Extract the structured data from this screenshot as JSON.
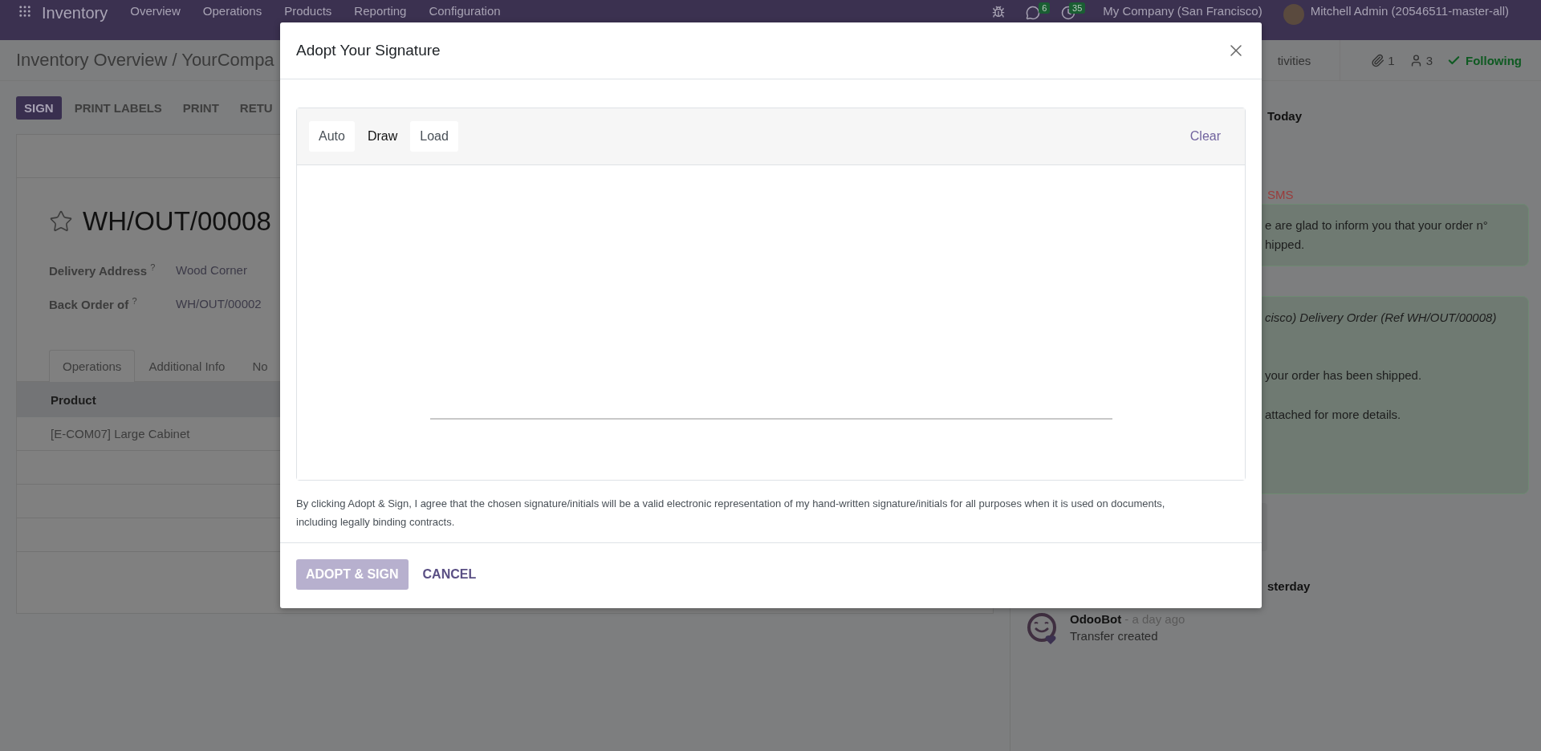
{
  "navbar": {
    "app_name": "Inventory",
    "menu": [
      "Overview",
      "Operations",
      "Products",
      "Reporting",
      "Configuration"
    ],
    "messages_badge": "6",
    "activities_badge": "35",
    "company": "My Company (San Francisco)",
    "user": "Mitchell Admin (20546511-master-all)"
  },
  "breadcrumb": "Inventory Overview / YourCompa",
  "action_buttons": [
    {
      "label": "SIGN",
      "primary": true
    },
    {
      "label": "PRINT LABELS",
      "primary": false
    },
    {
      "label": "PRINT",
      "primary": false
    },
    {
      "label": "RETU",
      "primary": false
    }
  ],
  "record": {
    "starred": false,
    "title": "WH/OUT/00008",
    "fields": [
      {
        "label": "Delivery Address",
        "help": "?",
        "value": "Wood Corner"
      },
      {
        "label": "Back Order of",
        "help": "?",
        "value": "WH/OUT/00002"
      }
    ],
    "tabs": [
      {
        "label": "Operations",
        "selected": true
      },
      {
        "label": "Additional Info",
        "selected": false
      },
      {
        "label": "No",
        "selected": false
      }
    ],
    "table": {
      "columns": [
        "Product"
      ],
      "rows": [
        [
          "[E-COM07] Large Cabinet"
        ]
      ]
    }
  },
  "chatter": {
    "activities_label": "tivities",
    "attachments": "1",
    "followers": "3",
    "following": "Following",
    "items": [
      {
        "kind": "day",
        "text": "Today"
      },
      {
        "kind": "label",
        "text": "SMS"
      },
      {
        "kind": "bubble",
        "lines": [
          {
            "text": "e are glad to inform you that your order n°",
            "italic": false
          },
          {
            "text": "hipped.",
            "italic": false
          }
        ]
      },
      {
        "kind": "bubble",
        "lines": [
          {
            "text": "cisco) Delivery Order (Ref WH/OUT/00008)",
            "italic": true
          },
          {
            "text": "your order has been shipped.",
            "italic": false
          },
          {
            "text": "attached for more details.",
            "italic": false
          }
        ]
      },
      {
        "kind": "day",
        "text": "sterday"
      },
      {
        "kind": "message",
        "author": "OdooBot",
        "time": "- a day ago",
        "body": "Transfer created"
      }
    ]
  },
  "modal": {
    "title": "Adopt Your Signature",
    "tabs": [
      {
        "label": "Auto",
        "selected": false
      },
      {
        "label": "Draw",
        "selected": true
      },
      {
        "label": "Load",
        "selected": false
      }
    ],
    "clear": "Clear",
    "legal": "By clicking Adopt & Sign, I agree that the chosen signature/initials will be a valid electronic representation of my hand-written signature/initials for all purposes when it is used on documents, including legally binding contracts.",
    "buttons": [
      {
        "label": "ADOPT & SIGN",
        "kind": "primary",
        "disabled": true
      },
      {
        "label": "CANCEL",
        "kind": "link",
        "disabled": false
      }
    ]
  }
}
